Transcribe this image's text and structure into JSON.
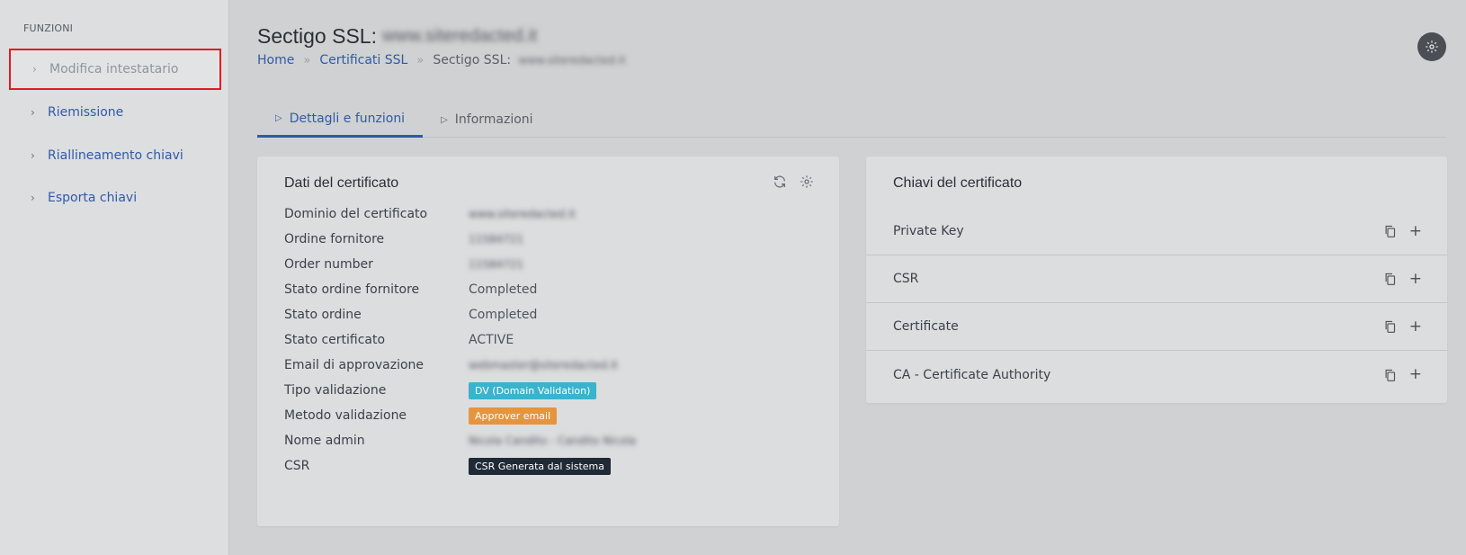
{
  "sidebar": {
    "heading": "FUNZIONI",
    "items": [
      {
        "label": "Modifica intestatario"
      },
      {
        "label": "Riemissione"
      },
      {
        "label": "Riallineamento chiavi"
      },
      {
        "label": "Esporta chiavi"
      }
    ]
  },
  "header": {
    "title": "Sectigo SSL:",
    "title_domain_blurred": "www.siteredacted.it",
    "breadcrumb": {
      "home": "Home",
      "certs": "Certificati SSL",
      "current": "Sectigo SSL:",
      "current_blurred": "www.siteredacted.it"
    }
  },
  "tabs": [
    {
      "label": "Dettagli e funzioni"
    },
    {
      "label": "Informazioni"
    }
  ],
  "certificate": {
    "title": "Dati del certificato",
    "rows": [
      {
        "label": "Dominio del certificato",
        "value": "www.siteredacted.it"
      },
      {
        "label": "Ordine fornitore",
        "value": "11584721"
      },
      {
        "label": "Order number",
        "value": "11584721"
      },
      {
        "label": "Stato ordine fornitore",
        "value": "Completed"
      },
      {
        "label": "Stato ordine",
        "value": "Completed"
      },
      {
        "label": "Stato certificato",
        "value": "ACTIVE"
      },
      {
        "label": "Email di approvazione",
        "value": "webmaster@siteredacted.it"
      },
      {
        "label": "Tipo validazione",
        "value": "DV (Domain Validation)"
      },
      {
        "label": "Metodo validazione",
        "value": "Approver email"
      },
      {
        "label": "Nome admin",
        "value": "Nicola Candito - Candito Nicola"
      },
      {
        "label": "CSR",
        "value": "CSR Generata dal sistema"
      }
    ]
  },
  "keys": {
    "title": "Chiavi del certificato",
    "items": [
      {
        "label": "Private Key"
      },
      {
        "label": "CSR"
      },
      {
        "label": "Certificate"
      },
      {
        "label": "CA - Certificate Authority"
      }
    ]
  },
  "colors": {
    "accent": "#2f5aa8",
    "badge_info": "#3ab3cd",
    "badge_warn": "#e5953e",
    "badge_dark": "#1f2a36",
    "highlight_border": "#e01b24"
  },
  "icons": {
    "top_right": "gear-icon",
    "card_refresh": "refresh-icon",
    "card_settings": "gear-icon",
    "copy": "copy-icon",
    "expand": "plus-icon"
  }
}
